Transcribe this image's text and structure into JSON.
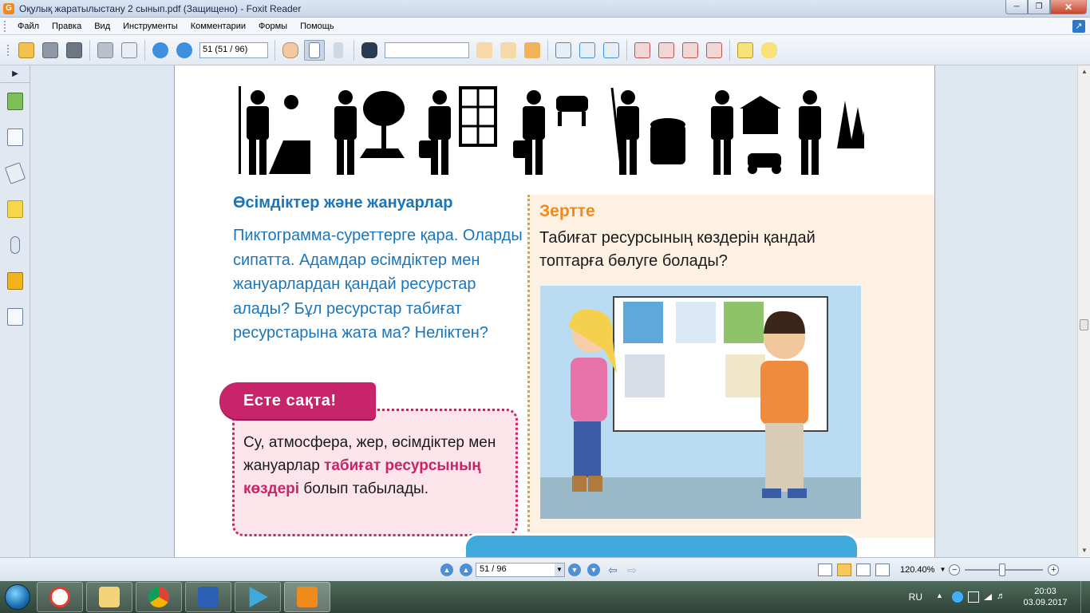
{
  "window": {
    "title": "Оқулық жаратылыстану 2 сынып.pdf (Защищено) - Foxit Reader",
    "app_icon": "foxit-icon",
    "controls": [
      "minimize",
      "maximize",
      "close"
    ]
  },
  "menu": {
    "items": [
      "Файл",
      "Правка",
      "Вид",
      "Инструменты",
      "Комментарии",
      "Формы",
      "Помощь"
    ]
  },
  "toolbar": {
    "page_field": "51 (51 / 96)",
    "search_placeholder": "",
    "icons": [
      "open-icon",
      "save-icon",
      "save-all-icon",
      "print-icon",
      "email-icon",
      "page-up-icon",
      "page-down-icon",
      "hand-tool-icon",
      "select-text-icon",
      "select-arrow-icon",
      "binoculars-icon",
      "prev-result-icon",
      "next-result-icon",
      "highlight-icon",
      "zoom-icon",
      "fit-page-icon",
      "fit-width-icon",
      "pdf-create-icon",
      "pdf-convert-icon",
      "pdf-export-icon",
      "pdf-merge-icon",
      "typewriter-icon",
      "note-icon"
    ]
  },
  "left_panel": {
    "icons": [
      "bookmark-icon",
      "pages-icon",
      "layers-icon",
      "comments-icon",
      "attachment-icon",
      "security-icon",
      "signature-icon"
    ]
  },
  "document": {
    "section_heading": "Өсімдіктер және жануарлар",
    "section_body": "Пиктограмма-суреттерге қара. Оларды сипатта. Адамдар өсімдіктер мен жануарлардан қандай ресурстар алады? Бұл ресурстар табиғат ресурстарына жата ма? Неліктен?",
    "zertte_title": "Зертте",
    "zertte_question": "Табиғат ресурсының көздерін қандай топтарға бөлуге болады?",
    "este_title": "Есте сақта!",
    "este_text_1": "Су, атмосфера, жер, өсімдіктер мен жануарлар",
    "este_text_em": "табиғат ресурсының көздері",
    "este_text_2": "болып табылады."
  },
  "statusbar": {
    "page_field": "51 / 96",
    "zoom": "120.40%",
    "zoom_slider_fraction": 0.48
  },
  "taskbar": {
    "apps": [
      "yandex-browser-icon",
      "file-explorer-icon",
      "chrome-icon",
      "word-icon",
      "media-player-icon",
      "foxit-pdf-icon"
    ],
    "active_index": 5,
    "language": "RU",
    "time": "20:03",
    "date": "03.09.2017"
  },
  "colors": {
    "heading_blue": "#1a75bb",
    "zertte_orange": "#f08a1c",
    "este_magenta": "#c8246a",
    "zertte_bg": "#fdf1e3",
    "este_bg": "#fbe4ea"
  }
}
